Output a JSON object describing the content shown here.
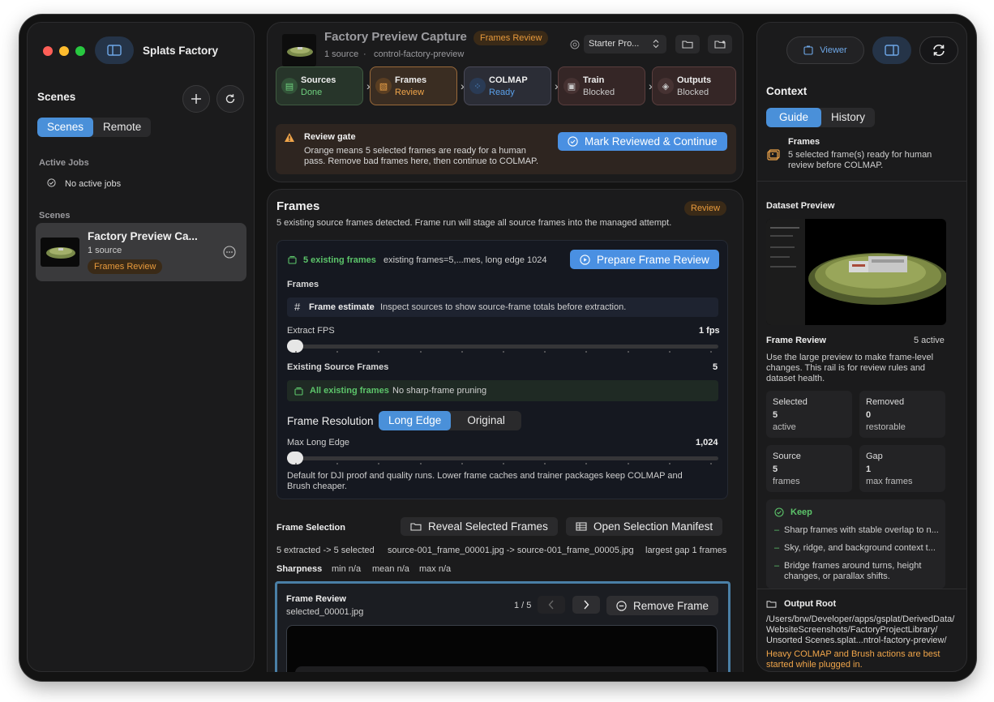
{
  "sidebar": {
    "app_title": "Splats Factory",
    "scenes_header": "Scenes",
    "tabs": [
      {
        "label": "Scenes",
        "active": true
      },
      {
        "label": "Remote",
        "active": false
      }
    ],
    "active_jobs_header": "Active Jobs",
    "no_jobs": "No active jobs",
    "scenes_section": "Scenes",
    "scene": {
      "title": "Factory Preview Ca...",
      "subtitle": "1 source",
      "badge": "Frames Review"
    }
  },
  "header": {
    "title": "Factory Preview Capture",
    "badge": "Frames Review",
    "source_count": "1 source",
    "dot": "·",
    "project_id": "control-factory-preview",
    "preset": "Starter Pro...",
    "stages": [
      {
        "label": "Sources",
        "status": "Done"
      },
      {
        "label": "Frames",
        "status": "Review"
      },
      {
        "label": "COLMAP",
        "status": "Ready"
      },
      {
        "label": "Train",
        "status": "Blocked"
      },
      {
        "label": "Outputs",
        "status": "Blocked"
      }
    ],
    "gate_title": "Review gate",
    "gate_text_1": "Orange means 5 selected frames are ready for a human",
    "gate_text_2": "pass. Remove bad frames here, then continue to COLMAP.",
    "gate_button": "Mark Reviewed & Continue"
  },
  "frames": {
    "title": "Frames",
    "badge": "Review",
    "description": "5 existing source frames detected. Frame run will stage all source frames into the managed attempt.",
    "existing_label": "5 existing frames",
    "existing_detail": "existing frames=5,...mes, long edge 1024",
    "prepare_button": "Prepare Frame Review",
    "frames_sub": "Frames",
    "estimate_title": "Frame estimate",
    "estimate_text": "Inspect sources to show source-frame totals before extraction.",
    "fps_label": "Extract FPS",
    "fps_value": "1 fps",
    "fps_fraction": 0.0,
    "existing_source_label": "Existing Source Frames",
    "existing_source_count": "5",
    "all_existing": "All existing frames",
    "no_pruning": "No sharp-frame pruning",
    "resolution_label": "Frame Resolution",
    "resolution_options": [
      {
        "label": "Long Edge",
        "active": true
      },
      {
        "label": "Original",
        "active": false
      }
    ],
    "max_edge_label": "Max Long Edge",
    "max_edge_value": "1,024",
    "max_edge_fraction": 0.0,
    "note_1": "Default for DJI proof and quality runs. Lower frame caches and trainer packages keep COLMAP and",
    "note_2": "Brush cheaper.",
    "selection_title": "Frame Selection",
    "reveal_button": "Reveal Selected Frames",
    "manifest_button": "Open Selection Manifest",
    "sel_summary": "5 extracted -> 5 selected",
    "sel_range": "source-001_frame_00001.jpg -> source-001_frame_00005.jpg",
    "sel_gap": "largest gap 1 frames",
    "sharpness_label": "Sharpness",
    "sharp_min": "min n/a",
    "sharp_mean": "mean n/a",
    "sharp_max": "max n/a",
    "review_title": "Frame Review",
    "review_file": "selected_00001.jpg",
    "review_pos": "1 / 5",
    "remove_button": "Remove Frame"
  },
  "context": {
    "viewer_button": "Viewer",
    "title": "Context",
    "tabs": [
      {
        "label": "Guide",
        "active": true
      },
      {
        "label": "History",
        "active": false
      }
    ],
    "frames_title": "Frames",
    "frames_text_1": "5 selected frame(s) ready for human",
    "frames_text_2": "review before COLMAP.",
    "dataset_preview": "Dataset Preview",
    "frame_review": "Frame Review",
    "active_count": "5 active",
    "fr_text_1": "Use the large preview to make frame-level",
    "fr_text_2": "changes. This rail is for review rules and",
    "fr_text_3": "dataset health.",
    "stats": [
      {
        "k": "Selected",
        "v": "5",
        "s": "active"
      },
      {
        "k": "Removed",
        "v": "0",
        "s": "restorable"
      },
      {
        "k": "Source",
        "v": "5",
        "s": "frames"
      },
      {
        "k": "Gap",
        "v": "1",
        "s": "max frames"
      }
    ],
    "keep_title": "Keep",
    "bullet": "–",
    "keep_items": [
      "Sharp frames with stable overlap to n...",
      "Sky, ridge, and background context t...",
      "Bridge frames around turns, height",
      "changes, or parallax shifts."
    ],
    "output_root": "Output Root",
    "path_1": "/Users/brw/Developer/apps/gsplat/DerivedData/",
    "path_2": "WebsiteScreenshots/FactoryProjectLibrary/",
    "path_3": "Unsorted Scenes.splat...ntrol-factory-preview/",
    "warn_1": "Heavy COLMAP and Brush actions are best",
    "warn_2": "started while plugged in."
  },
  "colors": {
    "accent": "#4a90e2",
    "orange": "#e89a3c",
    "green": "#5cc46a",
    "blue_status": "#5aa0ea"
  }
}
